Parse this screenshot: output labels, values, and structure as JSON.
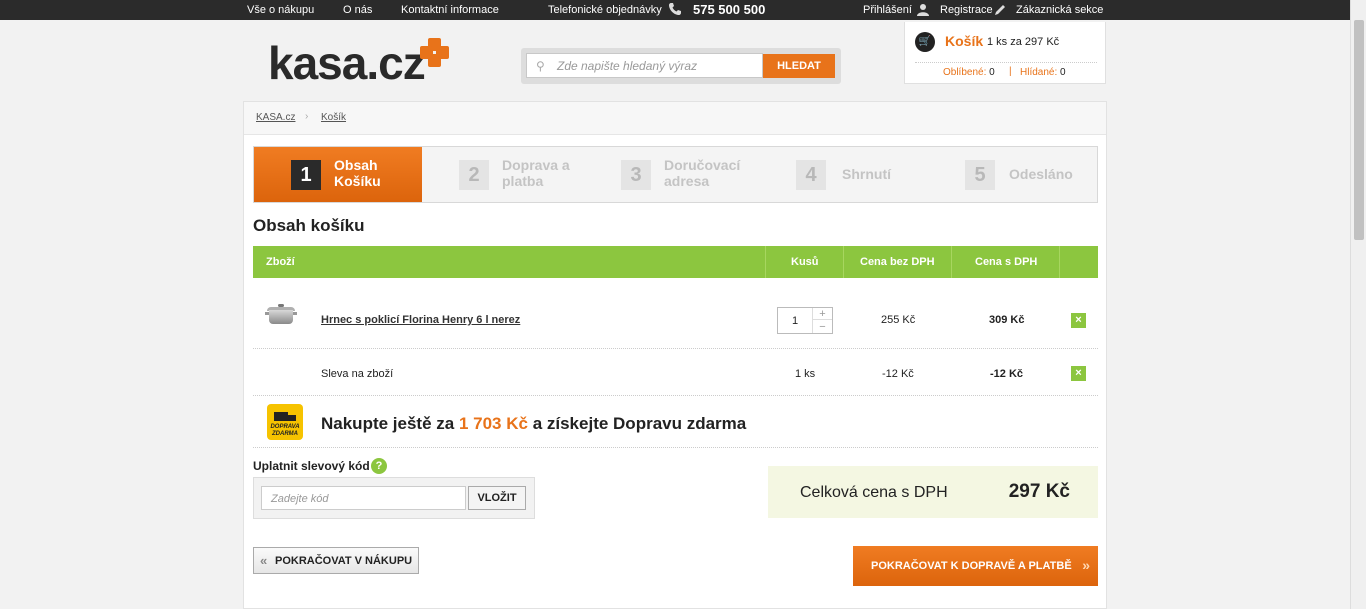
{
  "topbar": {
    "links": [
      "Vše o nákupu",
      "O nás",
      "Kontaktní informace"
    ],
    "phone_label": "Telefonické objednávky",
    "phone_number": "575 500 500",
    "login": "Přihlášení",
    "register": "Registrace",
    "customer": "Zákaznická sekce"
  },
  "header": {
    "logo_text": "kasa.cz",
    "search_placeholder": "Zde napište hledaný výraz",
    "search_button": "HLEDAT"
  },
  "cart": {
    "title": "Košík",
    "info": "1 ks za 297 Kč",
    "favorites_label": "Oblíbené:",
    "favorites_count": "0",
    "watched_label": "Hlídané:",
    "watched_count": "0"
  },
  "breadcrumb": [
    "KASA.cz",
    "Košík"
  ],
  "steps": [
    {
      "num": "1",
      "line1": "Obsah",
      "line2": "Košíku"
    },
    {
      "num": "2",
      "line1": "Doprava a",
      "line2": "platba"
    },
    {
      "num": "3",
      "line1": "Doručovací",
      "line2": "adresa"
    },
    {
      "num": "4",
      "line1": "Shrnutí",
      "line2": ""
    },
    {
      "num": "5",
      "line1": "Odesláno",
      "line2": ""
    }
  ],
  "section_title": "Obsah košíku",
  "table": {
    "headers": [
      "Zboží",
      "Kusů",
      "Cena bez DPH",
      "Cena s DPH"
    ],
    "product": {
      "name": "Hrnec s poklicí Florina Henry 6 l nerez",
      "qty": "1",
      "price_net": "255 Kč",
      "price_gross": "309 Kč"
    },
    "discount": {
      "name": "Sleva na zboží",
      "qty": "1 ks",
      "price_net": "-12 Kč",
      "price_gross": "-12 Kč"
    },
    "remove_symbol": "×"
  },
  "free_shipping": {
    "badge_line1": "DOPRAVA",
    "badge_line2": "ZDARMA",
    "prefix": "Nakupte ještě za",
    "amount": "1 703 Kč",
    "suffix": "a získejte Dopravu zdarma"
  },
  "voucher": {
    "label": "Uplatnit slevový kód",
    "help": "?",
    "placeholder": "Zadejte kód",
    "button": "VLOŽIT"
  },
  "total": {
    "label": "Celková cena s DPH",
    "value": "297 Kč"
  },
  "buttons": {
    "back": "POKRAČOVAT V NÁKUPU",
    "next": "POKRAČOVAT K DOPRAVĚ A PLATBĚ"
  },
  "colors": {
    "accent": "#e8731a",
    "green": "#8cc63f"
  }
}
